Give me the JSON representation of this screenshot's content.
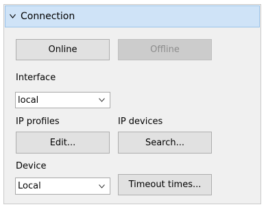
{
  "connection": {
    "header_title": "Connection",
    "chevron_icon": "chevron-down-icon",
    "online_label": "Online",
    "offline_label": "Offline",
    "interface_label": "Interface",
    "interface_value": "local",
    "ip_profiles_label": "IP profiles",
    "ip_devices_label": "IP devices",
    "edit_label": "Edit...",
    "search_label": "Search...",
    "device_label": "Device",
    "device_value": "Local",
    "timeout_label": "Timeout times...",
    "colors": {
      "header_bg": "#cfe3f7",
      "header_border": "#99c3ea",
      "panel_bg": "#f0f0f0",
      "button_bg": "#e1e1e1",
      "disabled_text": "#8c8c8c"
    }
  }
}
